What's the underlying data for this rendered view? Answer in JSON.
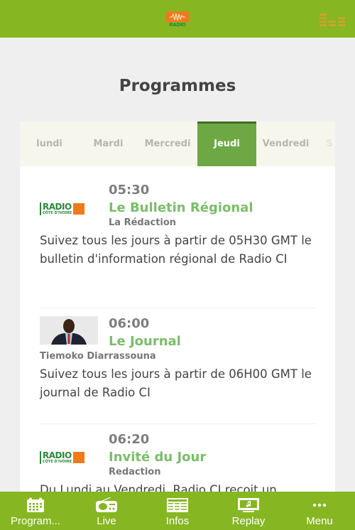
{
  "app": {
    "logo_text": "RADIO",
    "title": "Programmes"
  },
  "tabs": [
    {
      "label": "lundi",
      "active": false
    },
    {
      "label": "Mardi",
      "active": false
    },
    {
      "label": "Mercredi",
      "active": false
    },
    {
      "label": "Jeudi",
      "active": true
    },
    {
      "label": "Vendredi",
      "active": false
    },
    {
      "label": "S",
      "active": false
    }
  ],
  "programs": [
    {
      "time": "05:30",
      "title": "Le Bulletin Régional",
      "host": "La Rédaction",
      "thumbnail": "radio-ci-logo",
      "logo_line1": "RADIO",
      "logo_line2": "CÔTE D'IVOIRE",
      "description": "Suivez tous les jours à partir de 05H30 GMT le bulletin d'information régional de Radio CI"
    },
    {
      "time": "06:00",
      "title": "Le Journal",
      "host": "Tiemoko Diarrassouna",
      "thumbnail": "presenter-photo",
      "description": "Suivez tous les jours à partir de 06H00 GMT le journal de Radio CI"
    },
    {
      "time": "06:20",
      "title": "Invité du Jour",
      "host": "Redaction",
      "thumbnail": "radio-ci-logo",
      "logo_line1": "RADIO",
      "logo_line2": "CÔTE D'IVOIRE",
      "description": "Du Lundi au Vendredi, Radio CI reçoit un"
    }
  ],
  "bottom_nav": [
    {
      "label": "Program...",
      "icon": "calendar-icon"
    },
    {
      "label": "Live",
      "icon": "radio-icon"
    },
    {
      "label": "Infos",
      "icon": "newspaper-icon"
    },
    {
      "label": "Replay",
      "icon": "replay-tv-icon"
    },
    {
      "label": "Menu",
      "icon": "more-dots-icon"
    }
  ],
  "colors": {
    "brand_green": "#86b622",
    "active_tab": "#6ea845",
    "title_green": "#7bbd6a",
    "brand_orange": "#ee7a1c"
  }
}
